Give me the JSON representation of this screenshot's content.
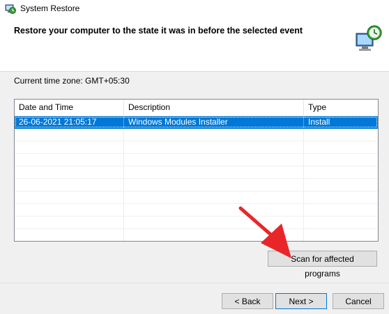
{
  "window": {
    "title": "System Restore"
  },
  "header": {
    "title": "Restore your computer to the state it was in before the selected event"
  },
  "timezone": {
    "label": "Current time zone: GMT+05:30"
  },
  "table": {
    "columns": [
      "Date and Time",
      "Description",
      "Type"
    ],
    "rows": [
      {
        "date_time": "26-06-2021 21:05:17",
        "description": "Windows Modules Installer",
        "type": "Install",
        "selected": true
      }
    ],
    "empty_row_count": 9
  },
  "buttons": {
    "scan": "Scan for affected programs",
    "back": "< Back",
    "next": "Next >",
    "cancel": "Cancel"
  },
  "colors": {
    "selection": "#0078d7",
    "annotation_arrow": "#e8262a"
  }
}
